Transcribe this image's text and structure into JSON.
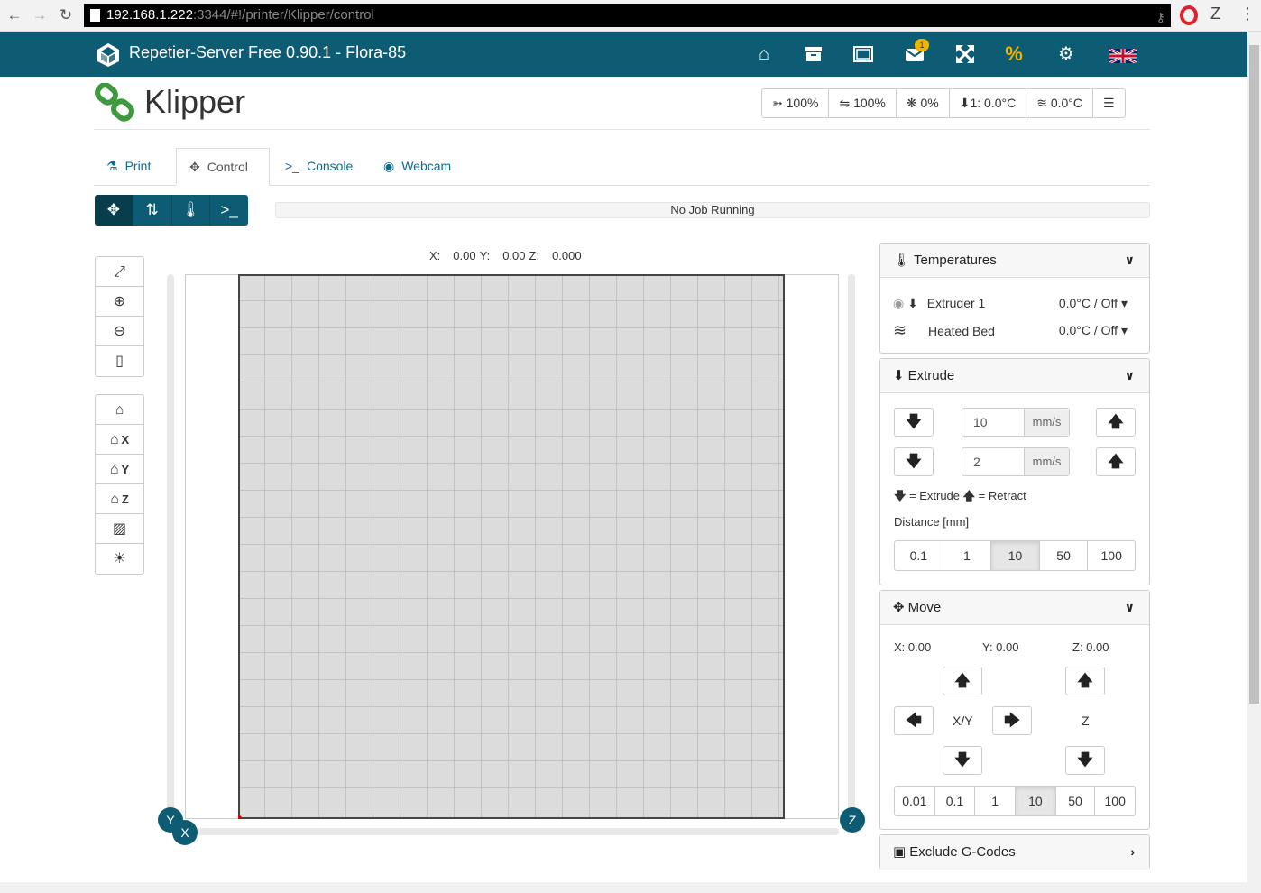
{
  "browser": {
    "url_host": "192.168.1.222",
    "url_path": ":3344/#!/printer/Klipper/control",
    "ext_z": "Z"
  },
  "app": {
    "title": "Repetier-Server Free 0.90.1 - Flora-85",
    "toolbar": {
      "percent_symbol": "%",
      "messages_badge": "1"
    }
  },
  "printer": {
    "name": "Klipper"
  },
  "status": {
    "speed": "100%",
    "flow": "100%",
    "fan": "0%",
    "extruder": "1: 0.0°C",
    "bed": "0.0°C"
  },
  "tabs": [
    {
      "label": "Print"
    },
    {
      "label": "Control"
    },
    {
      "label": "Console"
    },
    {
      "label": "Webcam"
    }
  ],
  "job": {
    "status": "No Job Running"
  },
  "position": {
    "x_label": "X:",
    "x": "0.00",
    "y_label": "Y:",
    "y": "0.00",
    "z_label": "Z:",
    "z": "0.000"
  },
  "home_buttons": {
    "x": "X",
    "y": "Y",
    "z": "Z"
  },
  "axis_labels": {
    "y": "Y",
    "x": "X",
    "z": "Z"
  },
  "temperatures": {
    "title": "Temperatures",
    "extruder_label": "Extruder 1",
    "extruder_value": "0.0°C / Off",
    "bed_label": "Heated Bed",
    "bed_value": "0.0°C / Off"
  },
  "extrude": {
    "title": "Extrude",
    "speed1": "10",
    "speed2": "2",
    "unit": "mm/s",
    "legend_extrude": "= Extrude",
    "legend_retract": "= Retract",
    "distance_label": "Distance [mm]",
    "distances": [
      "0.1",
      "1",
      "10",
      "50",
      "100"
    ],
    "selected": "10"
  },
  "move": {
    "title": "Move",
    "x": "X: 0.00",
    "y": "Y: 0.00",
    "z": "Z: 0.00",
    "xy_label": "X/Y",
    "z_label": "Z",
    "steps": [
      "0.01",
      "0.1",
      "1",
      "10",
      "50",
      "100"
    ],
    "selected": "10"
  },
  "exclude": {
    "title": "Exclude G-Codes"
  },
  "colors": {
    "header": "#0d5c73",
    "accent": "#f0b400",
    "link": "#0d6b8a"
  }
}
